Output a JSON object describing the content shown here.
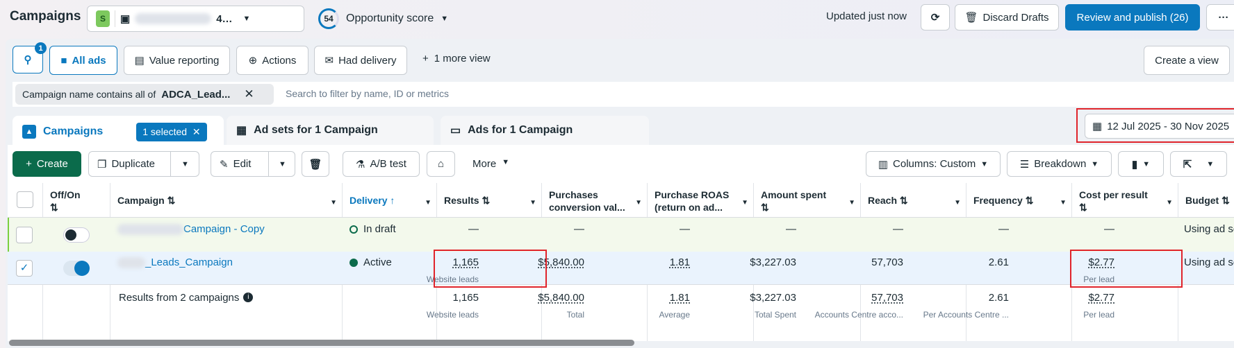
{
  "header": {
    "title": "Campaigns",
    "account_badge": "S",
    "account_name": "4…",
    "opportunity_score": "54",
    "opportunity_label": "Opportunity score",
    "updated": "Updated just now",
    "discard": "Discard Drafts",
    "review": "Review and publish (26)",
    "more": "···"
  },
  "views": {
    "search_badge": "1",
    "all_ads": "All ads",
    "value_reporting": "Value reporting",
    "actions": "Actions",
    "had_delivery": "Had delivery",
    "more_view": "1 more view",
    "create_view": "Create a view"
  },
  "filter": {
    "chip_prefix": "Campaign name contains all of",
    "chip_value": "ADCA_Lead...",
    "placeholder": "Search to filter by name, ID or metrics"
  },
  "tabs": {
    "campaigns": "Campaigns",
    "selected": "1 selected",
    "adsets": "Ad sets for 1 Campaign",
    "ads": "Ads for 1 Campaign",
    "date_range": "12 Jul 2025 - 30 Nov 2025"
  },
  "toolbar": {
    "create": "Create",
    "duplicate": "Duplicate",
    "edit": "Edit",
    "ab_test": "A/B test",
    "more": "More",
    "columns": "Columns: Custom",
    "breakdown": "Breakdown"
  },
  "columns": {
    "offon": "Off/On",
    "campaign": "Campaign",
    "delivery": "Delivery",
    "results": "Results",
    "purchases": "Purchases conversion val...",
    "roas": "Purchase ROAS (return on ad...",
    "amount": "Amount spent",
    "reach": "Reach",
    "frequency": "Frequency",
    "cost": "Cost per result",
    "budget": "Budget"
  },
  "rows": [
    {
      "name": "Campaign - Copy",
      "delivery": "In draft",
      "results": "—",
      "purchases": "—",
      "roas": "—",
      "amount": "—",
      "reach": "—",
      "frequency": "—",
      "cost": "—",
      "budget": "Using ad se"
    },
    {
      "name": "_Leads_Campaign",
      "delivery": "Active",
      "results": "1,165",
      "results_sub": "Website leads",
      "purchases": "$5,840.00",
      "roas": "1.81",
      "amount": "$3,227.03",
      "reach": "57,703",
      "frequency": "2.61",
      "cost": "$2.77",
      "cost_sub": "Per lead",
      "budget": "Using ad se"
    }
  ],
  "summary": {
    "label": "Results from 2 campaigns",
    "results": "1,165",
    "results_sub": "Website leads",
    "purchases": "$5,840.00",
    "purchases_sub": "Total",
    "roas": "1.81",
    "roas_sub": "Average",
    "amount": "$3,227.03",
    "amount_sub": "Total Spent",
    "reach": "57,703",
    "reach_sub": "Accounts Centre acco...",
    "frequency": "2.61",
    "frequency_sub": "Per Accounts Centre ...",
    "cost": "$2.77",
    "cost_sub": "Per lead"
  }
}
